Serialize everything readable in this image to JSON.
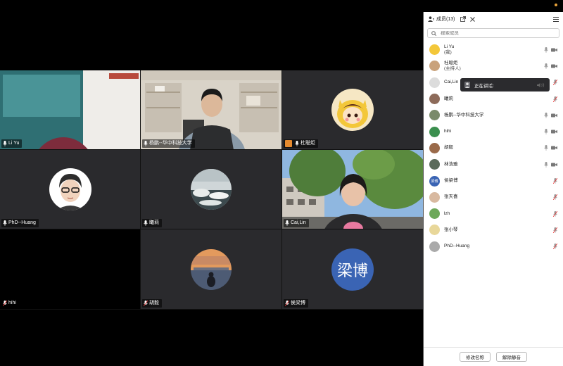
{
  "panel": {
    "title": "成员(13)",
    "search_placeholder": "搜索成员",
    "speaking_label": "正在讲话:",
    "footer": {
      "rename": "修改名称",
      "unmute_all": "解除静音"
    }
  },
  "tiles": [
    {
      "name": "Li Yu"
    },
    {
      "name": "杨鹏--华中科技大学"
    },
    {
      "name": "杜聪炬"
    },
    {
      "name": "PhD--Huang"
    },
    {
      "name": "曦莉"
    },
    {
      "name": "Cai,Lin"
    },
    {
      "name": "hihi"
    },
    {
      "name": "胡毅"
    },
    {
      "name": "侯梁博",
      "avatar_text": "梁博"
    }
  ],
  "members": [
    {
      "name": "Li Yu",
      "sub": "(我)"
    },
    {
      "name": "杜聪炬",
      "sub": "(主持人)"
    },
    {
      "name": "Cai,Lin",
      "sub": ""
    },
    {
      "name": "曦莉",
      "sub": ""
    },
    {
      "name": "杨鹏--华中科技大学",
      "sub": ""
    },
    {
      "name": "hihi",
      "sub": ""
    },
    {
      "name": "胡毅",
      "sub": ""
    },
    {
      "name": "林浩雅",
      "sub": ""
    },
    {
      "name": "侯梁博",
      "sub": "",
      "avatar_text": "梁博"
    },
    {
      "name": "张天喜",
      "sub": ""
    },
    {
      "name": "lzh",
      "sub": ""
    },
    {
      "name": "张小琴",
      "sub": ""
    },
    {
      "name": "PhD--Huang",
      "sub": ""
    }
  ]
}
